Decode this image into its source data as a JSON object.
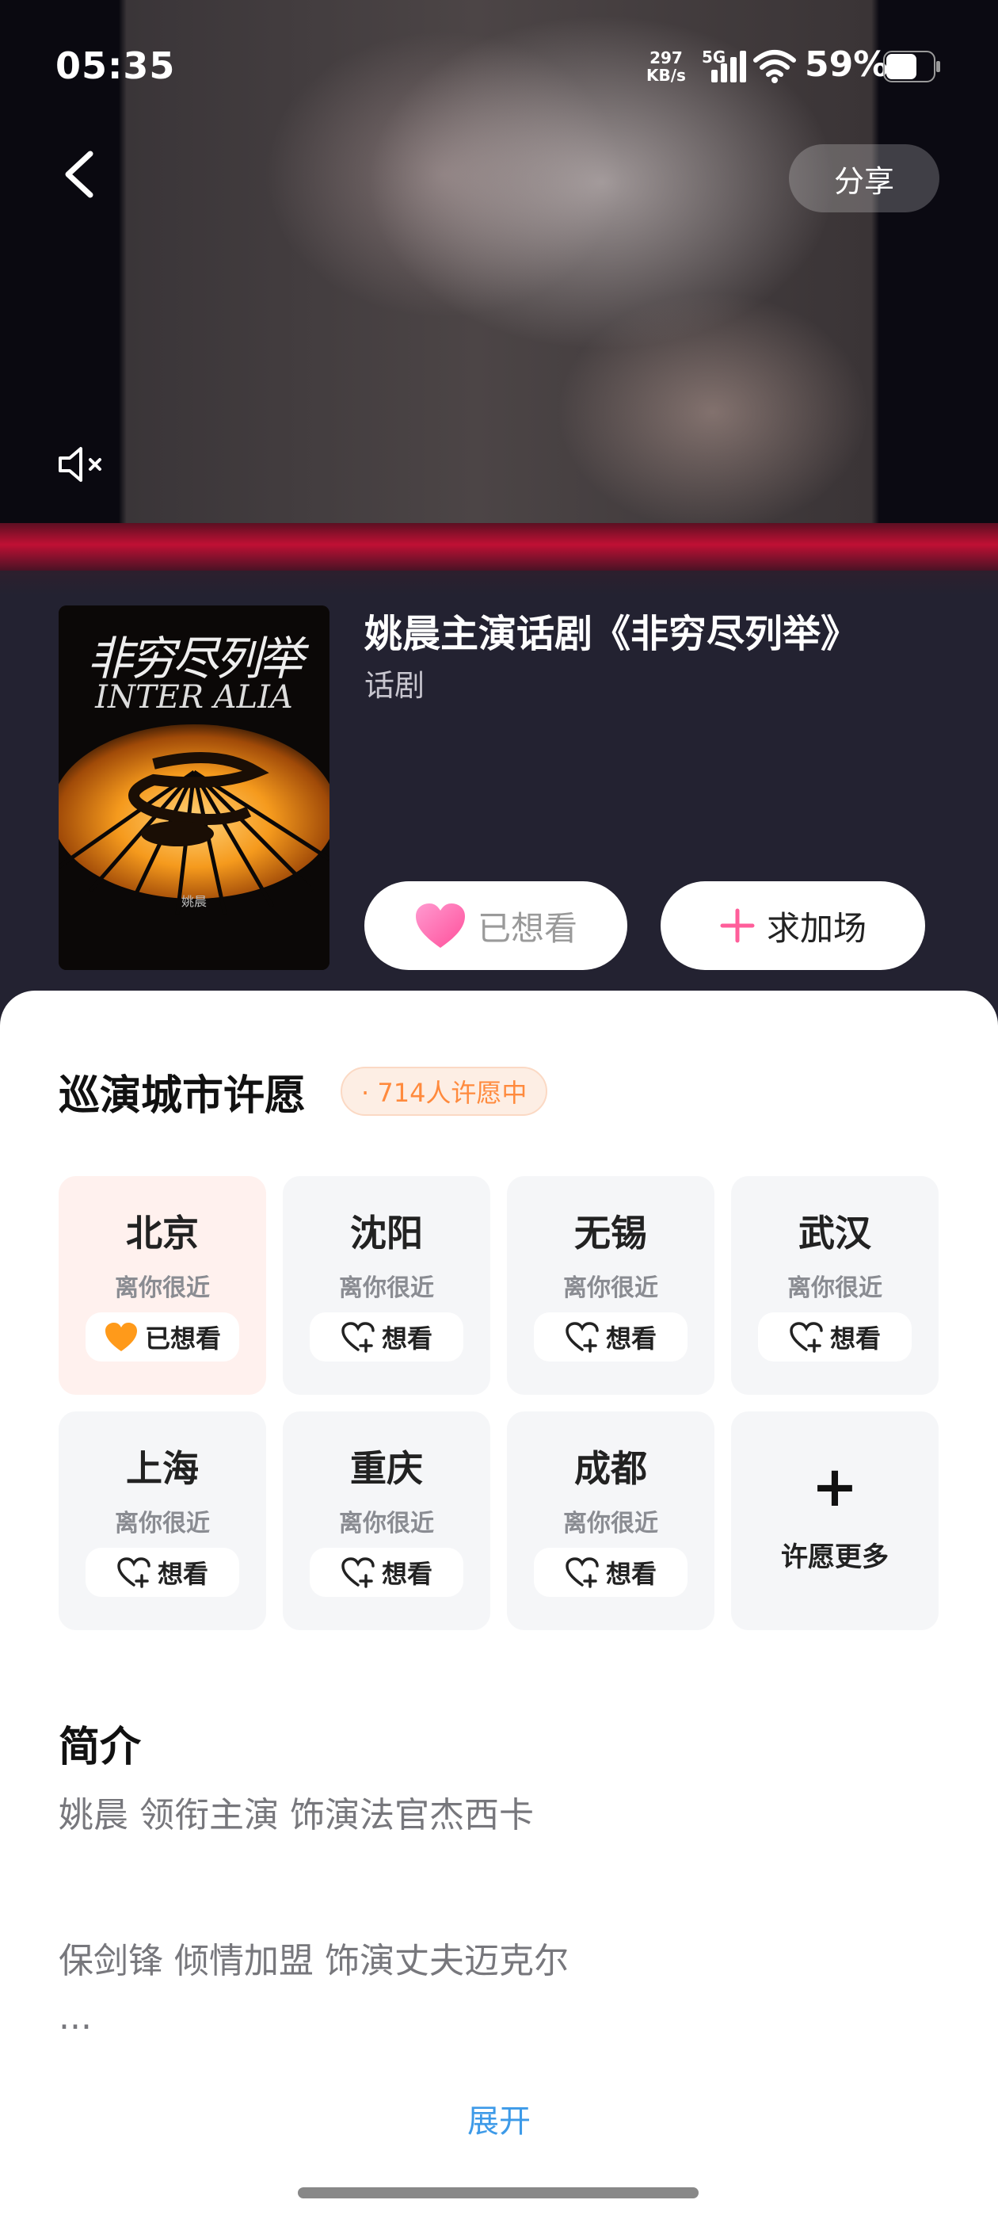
{
  "status_bar": {
    "time": "05:35",
    "net_speed_value": "297",
    "net_speed_unit": "KB/s",
    "network": "5G",
    "battery": "59%"
  },
  "header": {
    "share_label": "分享"
  },
  "poster": {
    "title_cn": "非穷尽列举",
    "title_en": "INTER ALIA",
    "credit": "姚晨"
  },
  "show": {
    "title": "姚晨主演话剧《非穷尽列举》",
    "category": "话剧",
    "want_label": "已想看",
    "add_label": "求加场"
  },
  "wish": {
    "title": "巡演城市许愿",
    "badge": "· 714人许愿中",
    "cities": [
      {
        "name": "北京",
        "sub": "离你很近",
        "action": "已想看"
      },
      {
        "name": "沈阳",
        "sub": "离你很近",
        "action": "想看"
      },
      {
        "name": "无锡",
        "sub": "离你很近",
        "action": "想看"
      },
      {
        "name": "武汉",
        "sub": "离你很近",
        "action": "想看"
      },
      {
        "name": "上海",
        "sub": "离你很近",
        "action": "想看"
      },
      {
        "name": "重庆",
        "sub": "离你很近",
        "action": "想看"
      },
      {
        "name": "成都",
        "sub": "离你很近",
        "action": "想看"
      }
    ],
    "more_label": "许愿更多"
  },
  "intro": {
    "title": "简介",
    "lines": [
      "姚晨  领衔主演 饰演法官杰西卡",
      "保剑锋  倾情加盟 饰演丈夫迈克尔",
      "..."
    ],
    "expand_label": "展开"
  },
  "colors": {
    "accent_pink": "#ff5e9a",
    "wish_orange": "#ff8a3d",
    "link_blue": "#3d9ae8"
  }
}
